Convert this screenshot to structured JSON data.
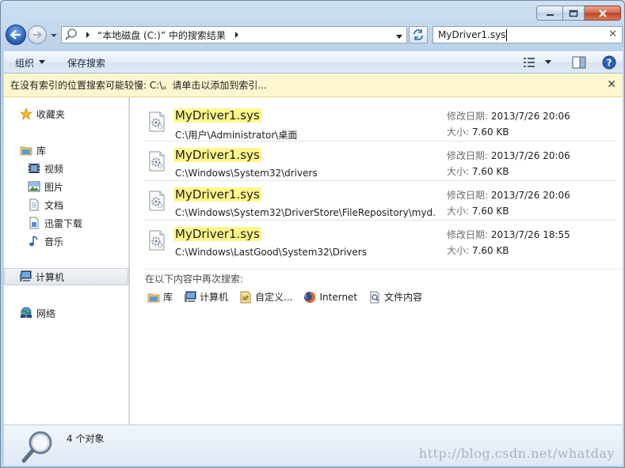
{
  "address": {
    "crumb": "“本地磁盘 (C:)” 中的搜索结果"
  },
  "search": {
    "query": "MyDriver1.sys"
  },
  "toolbar": {
    "organize_label": "组织",
    "save_search_label": "保存搜索"
  },
  "infobar": {
    "text": "在没有索引的位置搜索可能较慢: C:\\。请单击以添加到索引..."
  },
  "nav": {
    "favorites": "收藏夹",
    "libraries": "库",
    "videos": "视频",
    "pictures": "图片",
    "documents": "文档",
    "thunder": "迅雷下载",
    "music": "音乐",
    "computer": "计算机",
    "network": "网络"
  },
  "results": [
    {
      "name": "MyDriver1.sys",
      "path": "C:\\用户\\Administrator\\桌面",
      "modified_label": "修改日期:",
      "modified": "2013/7/26 20:06",
      "size_label": "大小:",
      "size": "7.60 KB"
    },
    {
      "name": "MyDriver1.sys",
      "path": "C:\\Windows\\System32\\drivers",
      "modified_label": "修改日期:",
      "modified": "2013/7/26 20:06",
      "size_label": "大小:",
      "size": "7.60 KB"
    },
    {
      "name": "MyDriver1.sys",
      "path": "C:\\Windows\\System32\\DriverStore\\FileRepository\\myd...",
      "modified_label": "修改日期:",
      "modified": "2013/7/26 20:06",
      "size_label": "大小:",
      "size": "7.60 KB"
    },
    {
      "name": "MyDriver1.sys",
      "path": "C:\\Windows\\LastGood\\System32\\Drivers",
      "modified_label": "修改日期:",
      "modified": "2013/7/26 18:55",
      "size_label": "大小:",
      "size": "7.60 KB"
    }
  ],
  "search_again": {
    "label": "在以下内容中再次搜索:",
    "items": [
      "库",
      "计算机",
      "自定义...",
      "Internet",
      "文件内容"
    ]
  },
  "status": {
    "count": "4 个对象"
  },
  "watermark": "http://blog.csdn.net/whatday"
}
